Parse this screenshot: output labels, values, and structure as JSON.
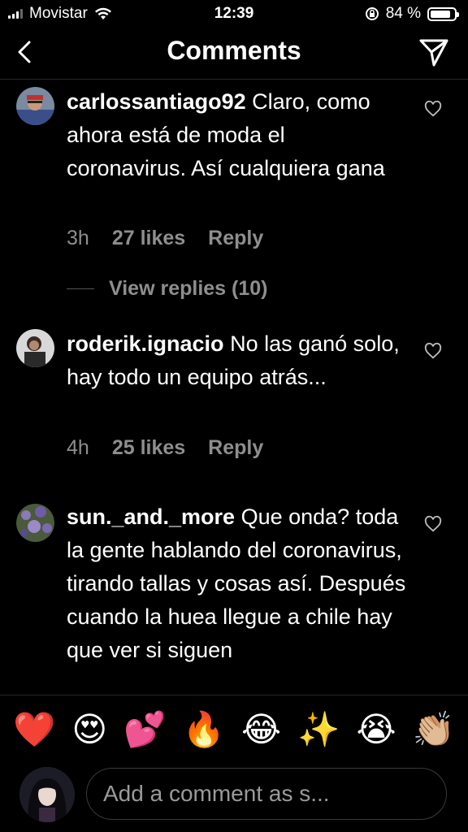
{
  "status": {
    "carrier": "Movistar",
    "time": "12:39",
    "battery": "84 %",
    "battery_level": 0.84
  },
  "header": {
    "title": "Comments",
    "back_icon": "chevron-left-icon",
    "send_icon": "paper-plane-icon"
  },
  "comments": [
    {
      "username": "carlossantiago92",
      "text": "Claro, como ahora está de moda el coronavirus. Así cualquiera gana",
      "time": "3h",
      "likes": "27 likes",
      "reply": "Reply",
      "view_replies": "View replies (10)"
    },
    {
      "username": "roderik.ignacio",
      "text": "No las ganó solo, hay todo un equipo atrás...",
      "time": "4h",
      "likes": "25 likes",
      "reply": "Reply"
    },
    {
      "username": "sun._and._more",
      "text": "Que onda? toda la gente hablando del coronavirus, tirando tallas y cosas así. Después cuando la huea llegue a chile hay que ver si siguen"
    }
  ],
  "emojis": [
    "❤️",
    "😍",
    "💕",
    "🔥",
    "😂",
    "✨",
    "😭",
    "👏🏼"
  ],
  "input": {
    "placeholder": "Add a comment as s..."
  }
}
